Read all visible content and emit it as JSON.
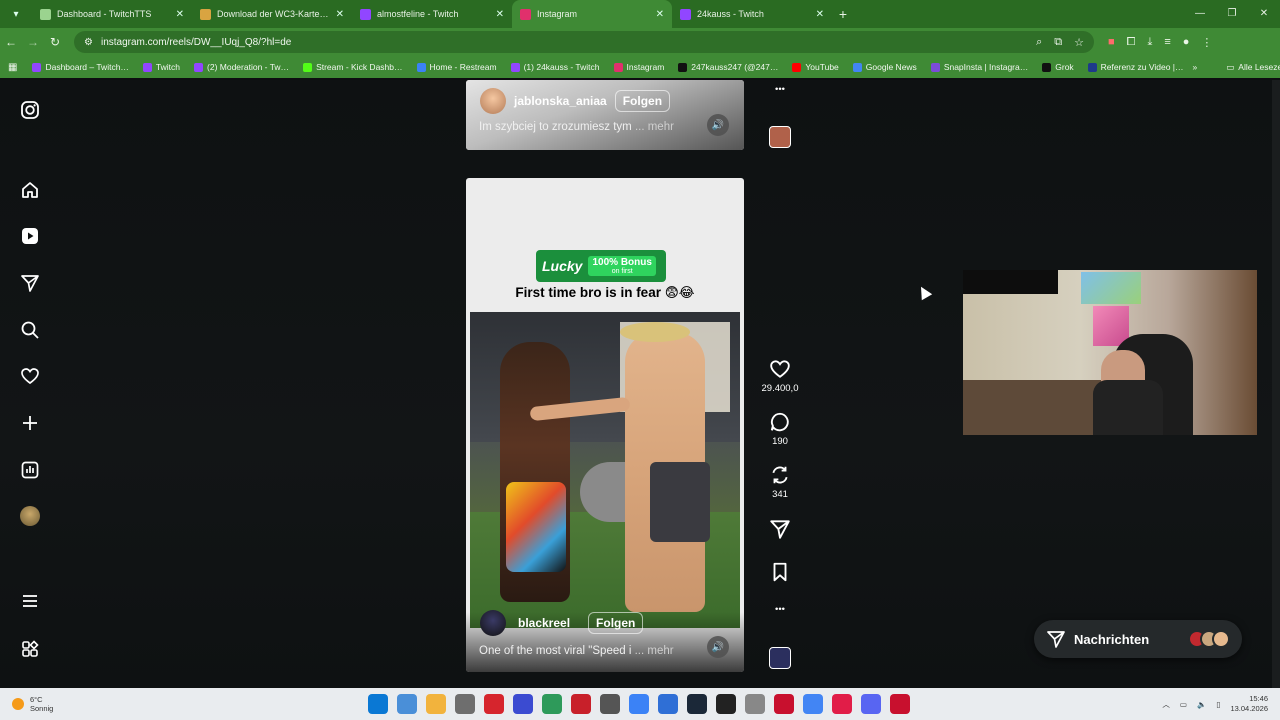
{
  "browser": {
    "tabs": [
      {
        "label": "Dashboard - TwitchTTS",
        "color": "#9bd38f",
        "active": false
      },
      {
        "label": "Download der WC3-Karte „Ani…",
        "color": "#d9a441",
        "active": false
      },
      {
        "label": "almostfeline - Twitch",
        "color": "#9146ff",
        "active": false
      },
      {
        "label": "Instagram",
        "color": "#e1306c",
        "active": true
      },
      {
        "label": "24kauss - Twitch",
        "color": "#9146ff",
        "active": false
      }
    ],
    "url": "instagram.com/reels/DW__IUqj_Q8/?hl=de",
    "bookmarks": [
      {
        "label": "Dashboard – Twitch…",
        "color": "#9146ff"
      },
      {
        "label": "Twitch",
        "color": "#9146ff"
      },
      {
        "label": "(2) Moderation - Tw…",
        "color": "#9146ff"
      },
      {
        "label": "Stream - Kick Dashb…",
        "color": "#53fc18"
      },
      {
        "label": "Home - Restream",
        "color": "#3b82f6"
      },
      {
        "label": "(1) 24kauss - Twitch",
        "color": "#9146ff"
      },
      {
        "label": "Instagram",
        "color": "#e1306c"
      },
      {
        "label": "247kauss247 (@247…",
        "color": "#111111"
      },
      {
        "label": "YouTube",
        "color": "#ff0000"
      },
      {
        "label": "Google News",
        "color": "#4285f4"
      },
      {
        "label": "SnapInsta | Instagra…",
        "color": "#7b4bd8"
      },
      {
        "label": "Grok",
        "color": "#111111"
      },
      {
        "label": "Referenz zu Video |…",
        "color": "#1e3a8a"
      }
    ],
    "all_bookmarks": "Alle Lesezeichen"
  },
  "sidenav": {
    "icons": [
      "instagram-logo-icon",
      "home-icon",
      "reels-icon",
      "send-icon",
      "search-icon",
      "heart-icon",
      "plus-icon",
      "insights-icon",
      "profile-avatar-icon",
      "menu-icon",
      "apps-icon"
    ]
  },
  "reel_prev": {
    "author": "jablonska_aniaa",
    "follow": "Folgen",
    "caption": "Im szybciej to zrozumiesz tym",
    "more": "... mehr"
  },
  "reel_main": {
    "brand": "Lucky",
    "bonus": "100% Bonus",
    "bonus_sub": "on first",
    "headline": "First time bro is in fear 😨😂",
    "author": "blackreel",
    "follow": "Folgen",
    "caption": "One of the most viral \"Speed i",
    "more": "... mehr"
  },
  "actions": {
    "likes": "29.400,0",
    "comments": "190",
    "reposts": "341"
  },
  "messages": {
    "label": "Nachrichten"
  },
  "taskbar": {
    "temp": "6°C",
    "weather": "Sonnig",
    "time": "15:46",
    "date": "13.04.2026"
  }
}
